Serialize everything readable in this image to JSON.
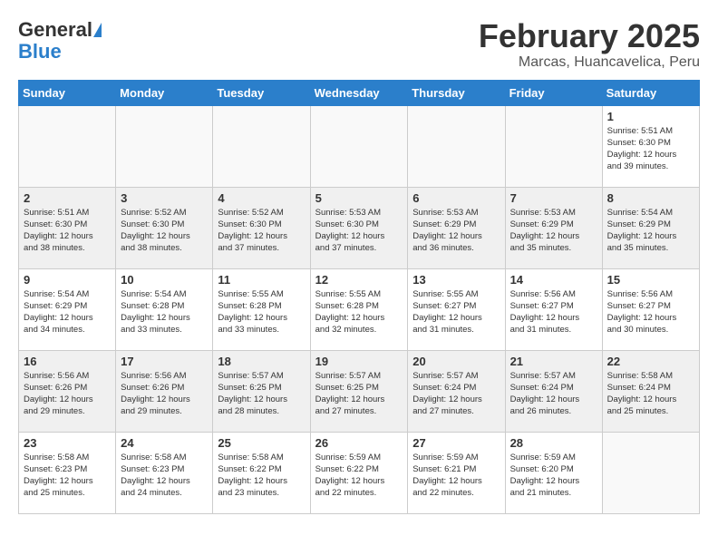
{
  "header": {
    "logo_general": "General",
    "logo_blue": "Blue",
    "month_title": "February 2025",
    "location": "Marcas, Huancavelica, Peru"
  },
  "weekdays": [
    "Sunday",
    "Monday",
    "Tuesday",
    "Wednesday",
    "Thursday",
    "Friday",
    "Saturday"
  ],
  "weeks": [
    [
      {
        "day": "",
        "info": ""
      },
      {
        "day": "",
        "info": ""
      },
      {
        "day": "",
        "info": ""
      },
      {
        "day": "",
        "info": ""
      },
      {
        "day": "",
        "info": ""
      },
      {
        "day": "",
        "info": ""
      },
      {
        "day": "1",
        "info": "Sunrise: 5:51 AM\nSunset: 6:30 PM\nDaylight: 12 hours\nand 39 minutes."
      }
    ],
    [
      {
        "day": "2",
        "info": "Sunrise: 5:51 AM\nSunset: 6:30 PM\nDaylight: 12 hours\nand 38 minutes."
      },
      {
        "day": "3",
        "info": "Sunrise: 5:52 AM\nSunset: 6:30 PM\nDaylight: 12 hours\nand 38 minutes."
      },
      {
        "day": "4",
        "info": "Sunrise: 5:52 AM\nSunset: 6:30 PM\nDaylight: 12 hours\nand 37 minutes."
      },
      {
        "day": "5",
        "info": "Sunrise: 5:53 AM\nSunset: 6:30 PM\nDaylight: 12 hours\nand 37 minutes."
      },
      {
        "day": "6",
        "info": "Sunrise: 5:53 AM\nSunset: 6:29 PM\nDaylight: 12 hours\nand 36 minutes."
      },
      {
        "day": "7",
        "info": "Sunrise: 5:53 AM\nSunset: 6:29 PM\nDaylight: 12 hours\nand 35 minutes."
      },
      {
        "day": "8",
        "info": "Sunrise: 5:54 AM\nSunset: 6:29 PM\nDaylight: 12 hours\nand 35 minutes."
      }
    ],
    [
      {
        "day": "9",
        "info": "Sunrise: 5:54 AM\nSunset: 6:29 PM\nDaylight: 12 hours\nand 34 minutes."
      },
      {
        "day": "10",
        "info": "Sunrise: 5:54 AM\nSunset: 6:28 PM\nDaylight: 12 hours\nand 33 minutes."
      },
      {
        "day": "11",
        "info": "Sunrise: 5:55 AM\nSunset: 6:28 PM\nDaylight: 12 hours\nand 33 minutes."
      },
      {
        "day": "12",
        "info": "Sunrise: 5:55 AM\nSunset: 6:28 PM\nDaylight: 12 hours\nand 32 minutes."
      },
      {
        "day": "13",
        "info": "Sunrise: 5:55 AM\nSunset: 6:27 PM\nDaylight: 12 hours\nand 31 minutes."
      },
      {
        "day": "14",
        "info": "Sunrise: 5:56 AM\nSunset: 6:27 PM\nDaylight: 12 hours\nand 31 minutes."
      },
      {
        "day": "15",
        "info": "Sunrise: 5:56 AM\nSunset: 6:27 PM\nDaylight: 12 hours\nand 30 minutes."
      }
    ],
    [
      {
        "day": "16",
        "info": "Sunrise: 5:56 AM\nSunset: 6:26 PM\nDaylight: 12 hours\nand 29 minutes."
      },
      {
        "day": "17",
        "info": "Sunrise: 5:56 AM\nSunset: 6:26 PM\nDaylight: 12 hours\nand 29 minutes."
      },
      {
        "day": "18",
        "info": "Sunrise: 5:57 AM\nSunset: 6:25 PM\nDaylight: 12 hours\nand 28 minutes."
      },
      {
        "day": "19",
        "info": "Sunrise: 5:57 AM\nSunset: 6:25 PM\nDaylight: 12 hours\nand 27 minutes."
      },
      {
        "day": "20",
        "info": "Sunrise: 5:57 AM\nSunset: 6:24 PM\nDaylight: 12 hours\nand 27 minutes."
      },
      {
        "day": "21",
        "info": "Sunrise: 5:57 AM\nSunset: 6:24 PM\nDaylight: 12 hours\nand 26 minutes."
      },
      {
        "day": "22",
        "info": "Sunrise: 5:58 AM\nSunset: 6:24 PM\nDaylight: 12 hours\nand 25 minutes."
      }
    ],
    [
      {
        "day": "23",
        "info": "Sunrise: 5:58 AM\nSunset: 6:23 PM\nDaylight: 12 hours\nand 25 minutes."
      },
      {
        "day": "24",
        "info": "Sunrise: 5:58 AM\nSunset: 6:23 PM\nDaylight: 12 hours\nand 24 minutes."
      },
      {
        "day": "25",
        "info": "Sunrise: 5:58 AM\nSunset: 6:22 PM\nDaylight: 12 hours\nand 23 minutes."
      },
      {
        "day": "26",
        "info": "Sunrise: 5:59 AM\nSunset: 6:22 PM\nDaylight: 12 hours\nand 22 minutes."
      },
      {
        "day": "27",
        "info": "Sunrise: 5:59 AM\nSunset: 6:21 PM\nDaylight: 12 hours\nand 22 minutes."
      },
      {
        "day": "28",
        "info": "Sunrise: 5:59 AM\nSunset: 6:20 PM\nDaylight: 12 hours\nand 21 minutes."
      },
      {
        "day": "",
        "info": ""
      }
    ]
  ]
}
